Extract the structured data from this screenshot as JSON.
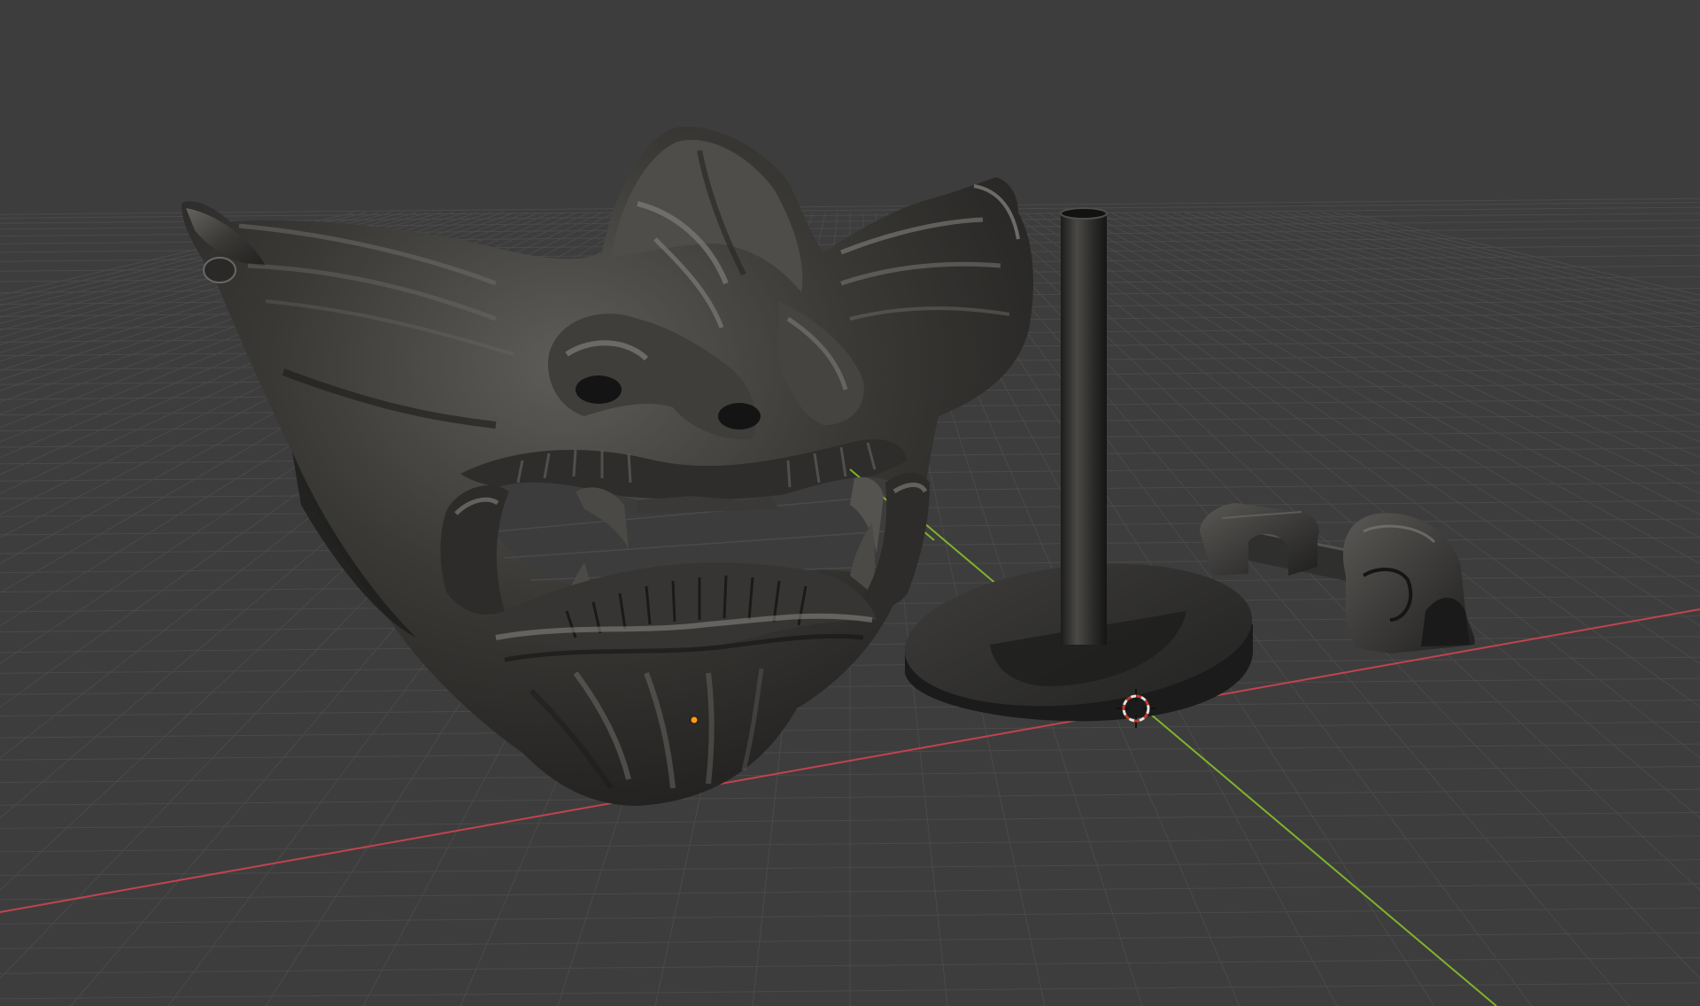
{
  "viewport": {
    "background_color": "#3d3d3d",
    "grid_color": "#4a4a4a",
    "x_axis_color": "#c2434f",
    "y_axis_color": "#7fb32b",
    "origin_dot_color": "#ff9a1f",
    "cursor_ring_colors": [
      "#e3e3e3",
      "#c0392b"
    ],
    "grid_visible": true
  },
  "objects": [
    {
      "name": "oni-mask",
      "material_color": "#2c2b29"
    },
    {
      "name": "display-stand",
      "material_color": "#262625"
    },
    {
      "name": "mounting-bracket",
      "material_color": "#2a2a29"
    }
  ],
  "icons": {
    "cursor": "3d-cursor-icon",
    "origin": "object-origin-icon"
  }
}
